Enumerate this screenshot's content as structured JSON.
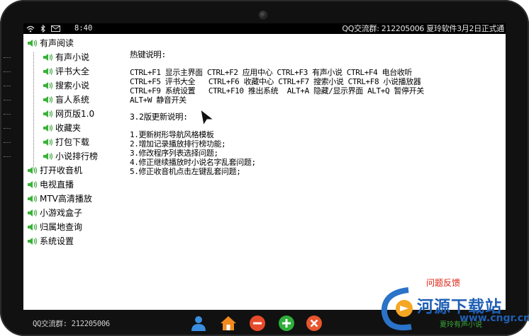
{
  "statusbar": {
    "time": "8:40",
    "right_text": "QQ交流群: 212205006 夏玲软件3月2日正式通",
    "icons": [
      "wifi-icon",
      "bluetooth-icon",
      "mail-icon"
    ]
  },
  "tree": {
    "root": "有声阅读",
    "children": [
      "有声小说",
      "评书大全",
      "搜索小说",
      "盲人系统",
      "网页版1.0",
      "收藏夹",
      "打包下载",
      "小说排行榜"
    ],
    "items": [
      "打开收音机",
      "电视直播",
      "MTV高清播放",
      "小游戏盒子",
      "归属地查询",
      "系统设置"
    ]
  },
  "content": {
    "hotkey_title": "热键说明:",
    "hotkey_lines": [
      "CTRL+F1 显示主界面 CTRL+F2 应用中心 CTRL+F3 有声小说 CTRL+F4 电台收听",
      "CTRL+F5 评书大全   CTRL+F6 收藏中心 CTRL+F7 搜索小说 CTRL+F8 小说播放器",
      "CTRL+F9 系统设置   CTRL+F10 推出系统  ALT+A 隐藏/显示界面 ALT+Q 暂停开关",
      "ALT+W 静音开关"
    ],
    "update_title": "3.2版更新说明:",
    "update_lines": [
      "1.更新树形导航风格模板",
      "2.增加记录播放排行榜功能;",
      "3.修改程序列表选择问题;",
      "4.修正继续播放时小说名字乱套问题;",
      "5.修正收音机点击左键乱套问题;"
    ]
  },
  "feedback_label": "问题反馈",
  "bottombar": {
    "qq_text": "QQ交流群: 212205006",
    "buttons": [
      "user-button",
      "home-button",
      "minus-button",
      "add-button",
      "close-button"
    ]
  },
  "watermark": {
    "text": "河源下载站",
    "url": "www.cngr.cn",
    "green_text": "夏玲有声小说"
  },
  "colors": {
    "bezel": "#111111",
    "accent_red": "#e02010",
    "user_blue": "#3a8ee0",
    "home_orange": "#f08a1c",
    "minus_red": "#e84b2c",
    "add_green": "#2fae3a",
    "close_red": "#e8552e",
    "speaker_green": "#3bb03b"
  }
}
